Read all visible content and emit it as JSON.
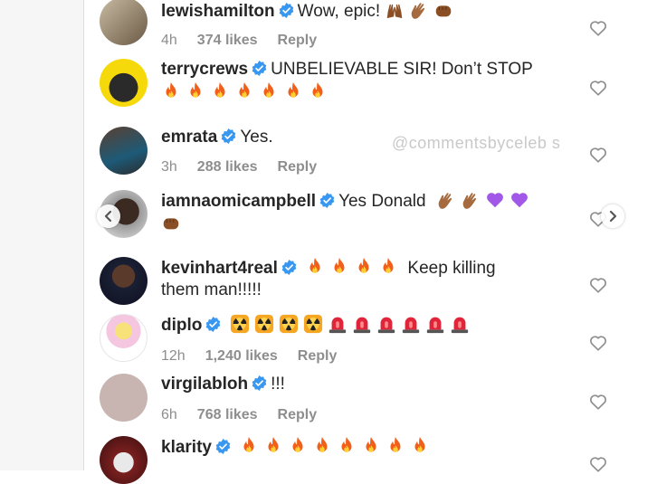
{
  "watermark": "@commentsbyceleb s",
  "comments": [
    {
      "username": "lewishamilton",
      "text": "Wow, epic!",
      "time": "4h",
      "likes": "374 likes",
      "reply": "Reply"
    },
    {
      "username": "terrycrews",
      "text": "UNBELIEVABLE SIR! Don’t STOP"
    },
    {
      "username": "emrata",
      "text": "Yes.",
      "time": "3h",
      "likes": "288 likes",
      "reply": "Reply"
    },
    {
      "username": "iamnaomicampbell",
      "text": "Yes Donald"
    },
    {
      "username": "kevinhart4real",
      "text": "Keep killing",
      "text2": "them man!!!!!"
    },
    {
      "username": "diplo",
      "time": "12h",
      "likes": "1,240 likes",
      "reply": "Reply"
    },
    {
      "username": "virgilabloh",
      "text": "!!!",
      "time": "6h",
      "likes": "768 likes",
      "reply": "Reply"
    },
    {
      "username": "klarity"
    }
  ],
  "colors": {
    "verified": "#3897f0",
    "fire": "#f0601a",
    "flame_inner": "#ffcf33",
    "purple_heart": "#a157e8",
    "clap_skin": "#a56b3e",
    "siren": "#e0243a"
  }
}
